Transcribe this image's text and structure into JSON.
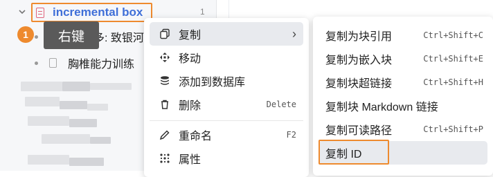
{
  "doc_tree": {
    "root_title": "incremental box",
    "root_count": "1",
    "child_1": "多: 致银河",
    "child_2": "胸椎能力训练"
  },
  "annotation": {
    "step_number": "1",
    "tooltip": "右键"
  },
  "context_menu": {
    "items": [
      {
        "icon": "copy-icon",
        "label": "复制",
        "shortcut": "",
        "has_submenu": true
      },
      {
        "icon": "move-icon",
        "label": "移动",
        "shortcut": ""
      },
      {
        "icon": "database-icon",
        "label": "添加到数据库",
        "shortcut": ""
      },
      {
        "icon": "trash-icon",
        "label": "删除",
        "shortcut": "Delete"
      },
      {
        "icon": "pencil-icon",
        "label": "重命名",
        "shortcut": "F2"
      },
      {
        "icon": "attributes-icon",
        "label": "属性",
        "shortcut": ""
      }
    ]
  },
  "copy_submenu": {
    "items": [
      {
        "label": "复制为块引用",
        "shortcut": "Ctrl+Shift+C"
      },
      {
        "label": "复制为嵌入块",
        "shortcut": "Ctrl+Shift+E"
      },
      {
        "label": "复制块超链接",
        "shortcut": "Ctrl+Shift+H"
      },
      {
        "label": "复制块 Markdown 链接",
        "shortcut": ""
      },
      {
        "label": "复制可读路径",
        "shortcut": "Ctrl+Shift+P"
      },
      {
        "label": "复制 ID",
        "shortcut": ""
      }
    ]
  },
  "colors": {
    "accent_orange": "#ee8a2e",
    "link_blue": "#3f6fd8",
    "doc_pink": "#e0637c"
  }
}
